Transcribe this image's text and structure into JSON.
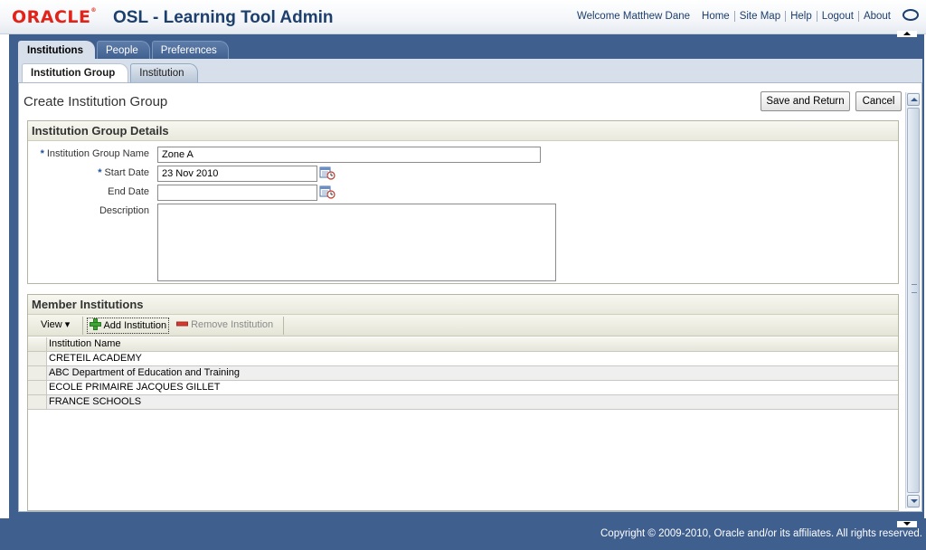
{
  "header": {
    "logo_text": "ORACLE",
    "app_title": "OSL - Learning Tool Admin",
    "welcome": "Welcome Matthew Dane",
    "links": [
      "Home",
      "Site Map",
      "Help",
      "Logout",
      "About"
    ]
  },
  "tabs_level1": [
    "Institutions",
    "People",
    "Preferences"
  ],
  "tabs_level2": [
    "Institution Group",
    "Institution"
  ],
  "page": {
    "title": "Create Institution Group",
    "save_label": "Save and Return",
    "cancel_label": "Cancel"
  },
  "details": {
    "header": "Institution Group Details",
    "required_mark": "*",
    "name_label": "Institution Group Name",
    "name_value": "Zone A",
    "start_label": "Start Date",
    "start_value": "23 Nov 2010",
    "end_label": "End Date",
    "end_value": "",
    "desc_label": "Description",
    "desc_value": ""
  },
  "members": {
    "header": "Member Institutions",
    "view_label": "View",
    "add_label": "Add Institution",
    "remove_label": "Remove Institution",
    "column": "Institution Name",
    "rows": [
      "CRETEIL ACADEMY",
      "ABC Department of Education and Training",
      "ECOLE PRIMAIRE JACQUES GILLET",
      "FRANCE SCHOOLS"
    ]
  },
  "footer": {
    "copyright": "Copyright © 2009-2010, Oracle and/or its affiliates. All rights reserved."
  },
  "colors": {
    "frame_blue": "#3f5f8f",
    "title_blue": "#1c3f6e",
    "oracle_red": "#e2231a"
  }
}
